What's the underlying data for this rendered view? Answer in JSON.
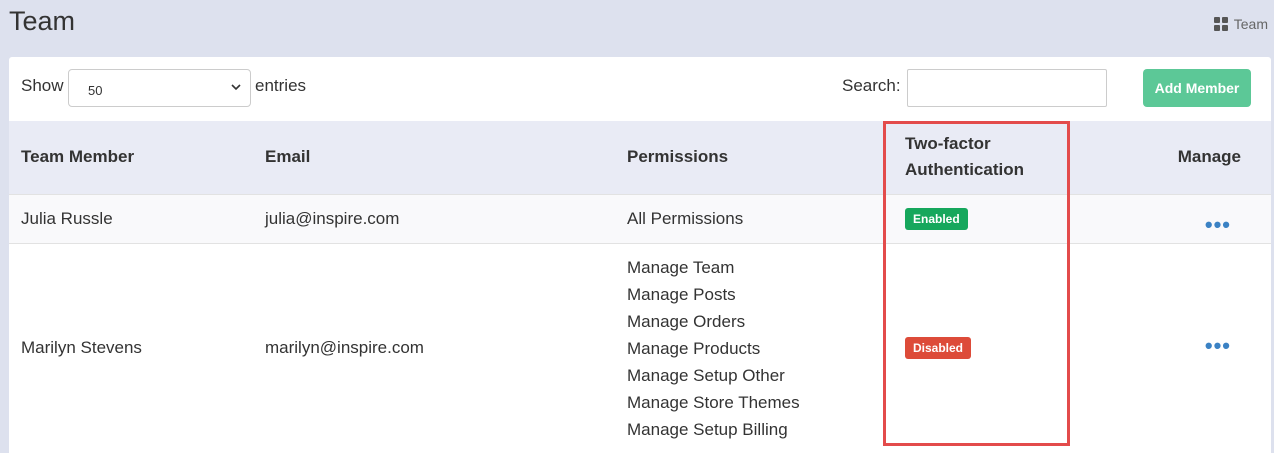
{
  "header": {
    "title": "Team",
    "breadcrumb": "Team"
  },
  "toolbar": {
    "show_label": "Show",
    "page_size": "50",
    "entries_label": "entries",
    "search_label": "Search:",
    "search_value": "",
    "add_button": "Add Member"
  },
  "table": {
    "headers": [
      "Team Member",
      "Email",
      "Permissions",
      "Two-factor Authentication",
      "Manage"
    ],
    "rows": [
      {
        "member": "Julia Russle",
        "email": "julia@inspire.com",
        "permissions": [
          "All Permissions"
        ],
        "two_factor": "Enabled",
        "manage": "•••"
      },
      {
        "member": "Marilyn Stevens",
        "email": "marilyn@inspire.com",
        "permissions": [
          "Manage Team",
          "Manage Posts",
          "Manage Orders",
          "Manage Products",
          "Manage Setup Other",
          "Manage Store Themes",
          "Manage Setup Billing"
        ],
        "two_factor": "Disabled",
        "manage": "•••"
      }
    ]
  },
  "colors": {
    "enabled": "#16a75c",
    "disabled": "#dd4b39",
    "add_button": "#5cc897",
    "highlight": "#e34b4b"
  }
}
